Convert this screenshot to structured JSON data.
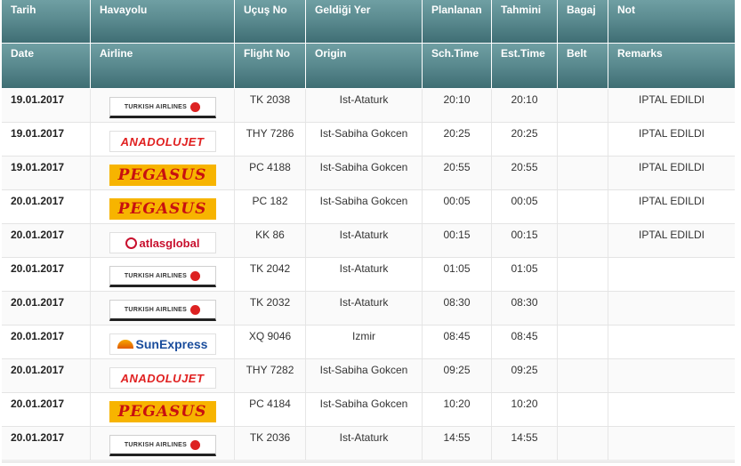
{
  "header_tr": [
    "Tarih",
    "Havayolu",
    "Uçuş No",
    "Geldiği Yer",
    "Planlanan",
    "Tahmini",
    "Bagaj",
    "Not"
  ],
  "header_en": [
    "Date",
    "Airline",
    "Flight No",
    "Origin",
    "Sch.Time",
    "Est.Time",
    "Belt",
    "Remarks"
  ],
  "airlines": {
    "thy": {
      "name": "TURKISH AIRLINES",
      "icon": "turkish-airlines-logo"
    },
    "ajet": {
      "name": "ANADOLUJET",
      "icon": "anadolujet-logo"
    },
    "pgs": {
      "name": "PEGASUS",
      "icon": "pegasus-logo"
    },
    "atlas": {
      "name": "atlasglobal",
      "icon": "atlasglobal-logo"
    },
    "sun": {
      "name": "SunExpress",
      "icon": "sunexpress-logo"
    }
  },
  "flights": [
    {
      "date": "19.01.2017",
      "airline": "thy",
      "flight": "TK 2038",
      "origin": "Ist-Ataturk",
      "sch": "20:10",
      "est": "20:10",
      "belt": "",
      "remarks": "IPTAL EDILDI"
    },
    {
      "date": "19.01.2017",
      "airline": "ajet",
      "flight": "THY 7286",
      "origin": "Ist-Sabiha Gokcen",
      "sch": "20:25",
      "est": "20:25",
      "belt": "",
      "remarks": "IPTAL EDILDI"
    },
    {
      "date": "19.01.2017",
      "airline": "pgs",
      "flight": "PC 4188",
      "origin": "Ist-Sabiha Gokcen",
      "sch": "20:55",
      "est": "20:55",
      "belt": "",
      "remarks": "IPTAL EDILDI"
    },
    {
      "date": "20.01.2017",
      "airline": "pgs",
      "flight": "PC 182",
      "origin": "Ist-Sabiha Gokcen",
      "sch": "00:05",
      "est": "00:05",
      "belt": "",
      "remarks": "IPTAL EDILDI"
    },
    {
      "date": "20.01.2017",
      "airline": "atlas",
      "flight": "KK 86",
      "origin": "Ist-Ataturk",
      "sch": "00:15",
      "est": "00:15",
      "belt": "",
      "remarks": "IPTAL EDILDI"
    },
    {
      "date": "20.01.2017",
      "airline": "thy",
      "flight": "TK 2042",
      "origin": "Ist-Ataturk",
      "sch": "01:05",
      "est": "01:05",
      "belt": "",
      "remarks": ""
    },
    {
      "date": "20.01.2017",
      "airline": "thy",
      "flight": "TK 2032",
      "origin": "Ist-Ataturk",
      "sch": "08:30",
      "est": "08:30",
      "belt": "",
      "remarks": ""
    },
    {
      "date": "20.01.2017",
      "airline": "sun",
      "flight": "XQ 9046",
      "origin": "Izmir",
      "sch": "08:45",
      "est": "08:45",
      "belt": "",
      "remarks": ""
    },
    {
      "date": "20.01.2017",
      "airline": "ajet",
      "flight": "THY 7282",
      "origin": "Ist-Sabiha Gokcen",
      "sch": "09:25",
      "est": "09:25",
      "belt": "",
      "remarks": ""
    },
    {
      "date": "20.01.2017",
      "airline": "pgs",
      "flight": "PC 4184",
      "origin": "Ist-Sabiha Gokcen",
      "sch": "10:20",
      "est": "10:20",
      "belt": "",
      "remarks": ""
    },
    {
      "date": "20.01.2017",
      "airline": "thy",
      "flight": "TK 2036",
      "origin": "Ist-Ataturk",
      "sch": "14:55",
      "est": "14:55",
      "belt": "",
      "remarks": ""
    }
  ],
  "colors": {
    "header_top": "#6f9fa3",
    "header_bottom": "#3f6e74",
    "remarks_text": "#333333"
  }
}
